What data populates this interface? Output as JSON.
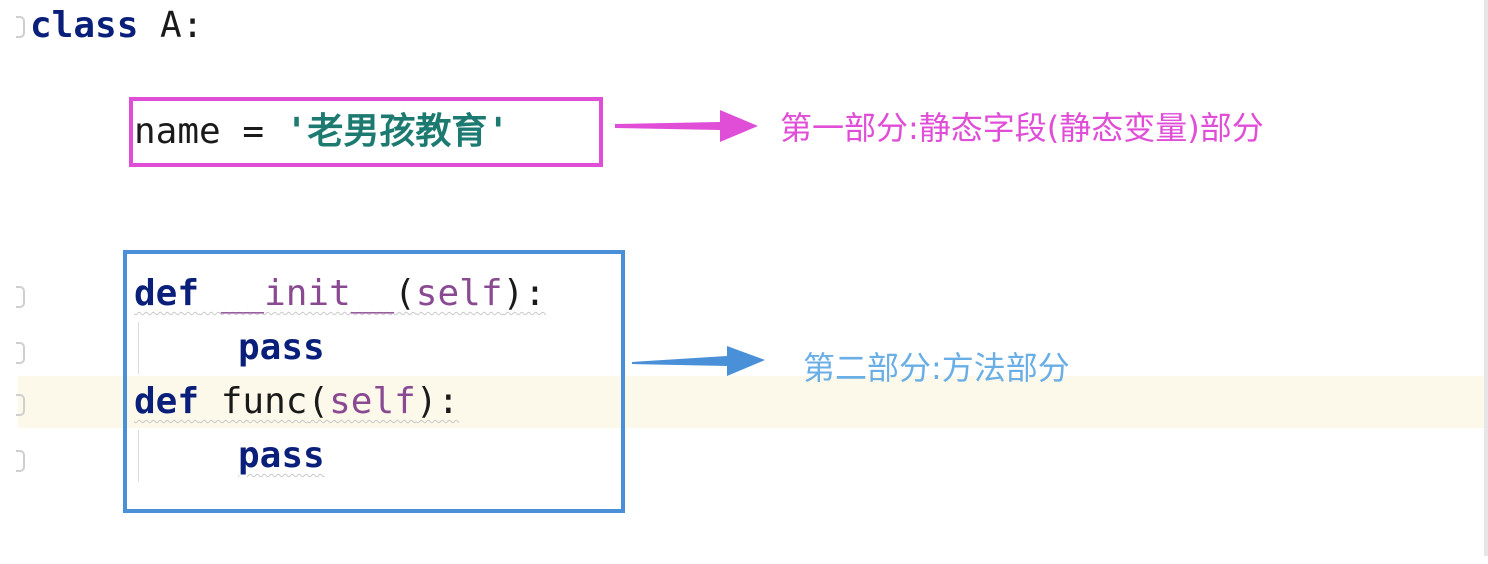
{
  "code": {
    "class_kw": "class",
    "class_name": " A:",
    "attr_name": "name",
    "attr_eq": " = ",
    "attr_value": "'老男孩教育'",
    "def_kw": "def",
    "init_name": "__init__",
    "func_name": "func",
    "self_param": "self",
    "paren_open": "(",
    "paren_close": "):",
    "pass_kw": "pass"
  },
  "annotations": {
    "static_field_label": "第一部分:静态字段(静态变量)部分",
    "method_label": "第二部分:方法部分",
    "colors": {
      "pink": "#e04ed8",
      "blue": "#4a90d9",
      "blue_text": "#6aaee6"
    }
  },
  "editor": {
    "highlight_color": "#fcf8ea"
  }
}
